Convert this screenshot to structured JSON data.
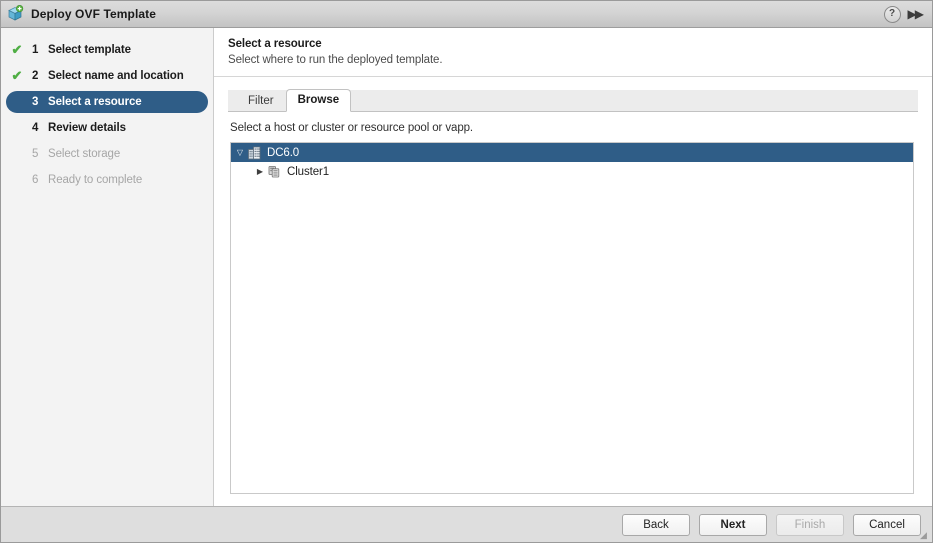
{
  "window": {
    "title": "Deploy OVF Template",
    "app_icon": "ovf-cube-add-icon",
    "help_label": "?",
    "collapse_label": "▶▶"
  },
  "sidebar": {
    "steps": [
      {
        "num": "1",
        "label": "Select template",
        "state": "done",
        "check": "✔"
      },
      {
        "num": "2",
        "label": "Select name and location",
        "state": "done",
        "check": "✔"
      },
      {
        "num": "3",
        "label": "Select a resource",
        "state": "selected",
        "check": ""
      },
      {
        "num": "4",
        "label": "Review details",
        "state": "enabled",
        "check": ""
      },
      {
        "num": "5",
        "label": "Select storage",
        "state": "disabled",
        "check": ""
      },
      {
        "num": "6",
        "label": "Ready to complete",
        "state": "disabled",
        "check": ""
      }
    ]
  },
  "main": {
    "page_title": "Select a resource",
    "page_subtitle": "Select where to run the deployed template.",
    "tabs": [
      {
        "label": "Filter",
        "active": false
      },
      {
        "label": "Browse",
        "active": true
      }
    ],
    "hint": "Select a host or cluster or resource pool or vapp.",
    "tree": [
      {
        "label": "DC6.0",
        "icon": "datacenter-icon",
        "expanded": true,
        "twisty": "▽",
        "selected": true,
        "level": 1
      },
      {
        "label": "Cluster1",
        "icon": "cluster-icon",
        "expanded": false,
        "twisty": "▶",
        "selected": false,
        "level": 2
      }
    ]
  },
  "footer": {
    "buttons": [
      {
        "label": "Back",
        "state": "enabled"
      },
      {
        "label": "Next",
        "state": "default"
      },
      {
        "label": "Finish",
        "state": "disabled"
      },
      {
        "label": "Cancel",
        "state": "enabled"
      }
    ]
  },
  "colors": {
    "accent_selected": "#2f5d87",
    "check_green": "#4fae44",
    "titlebar": "#d4d4d4",
    "sidebar_bg": "#f3f3f3",
    "footer_bg": "#dedede"
  }
}
